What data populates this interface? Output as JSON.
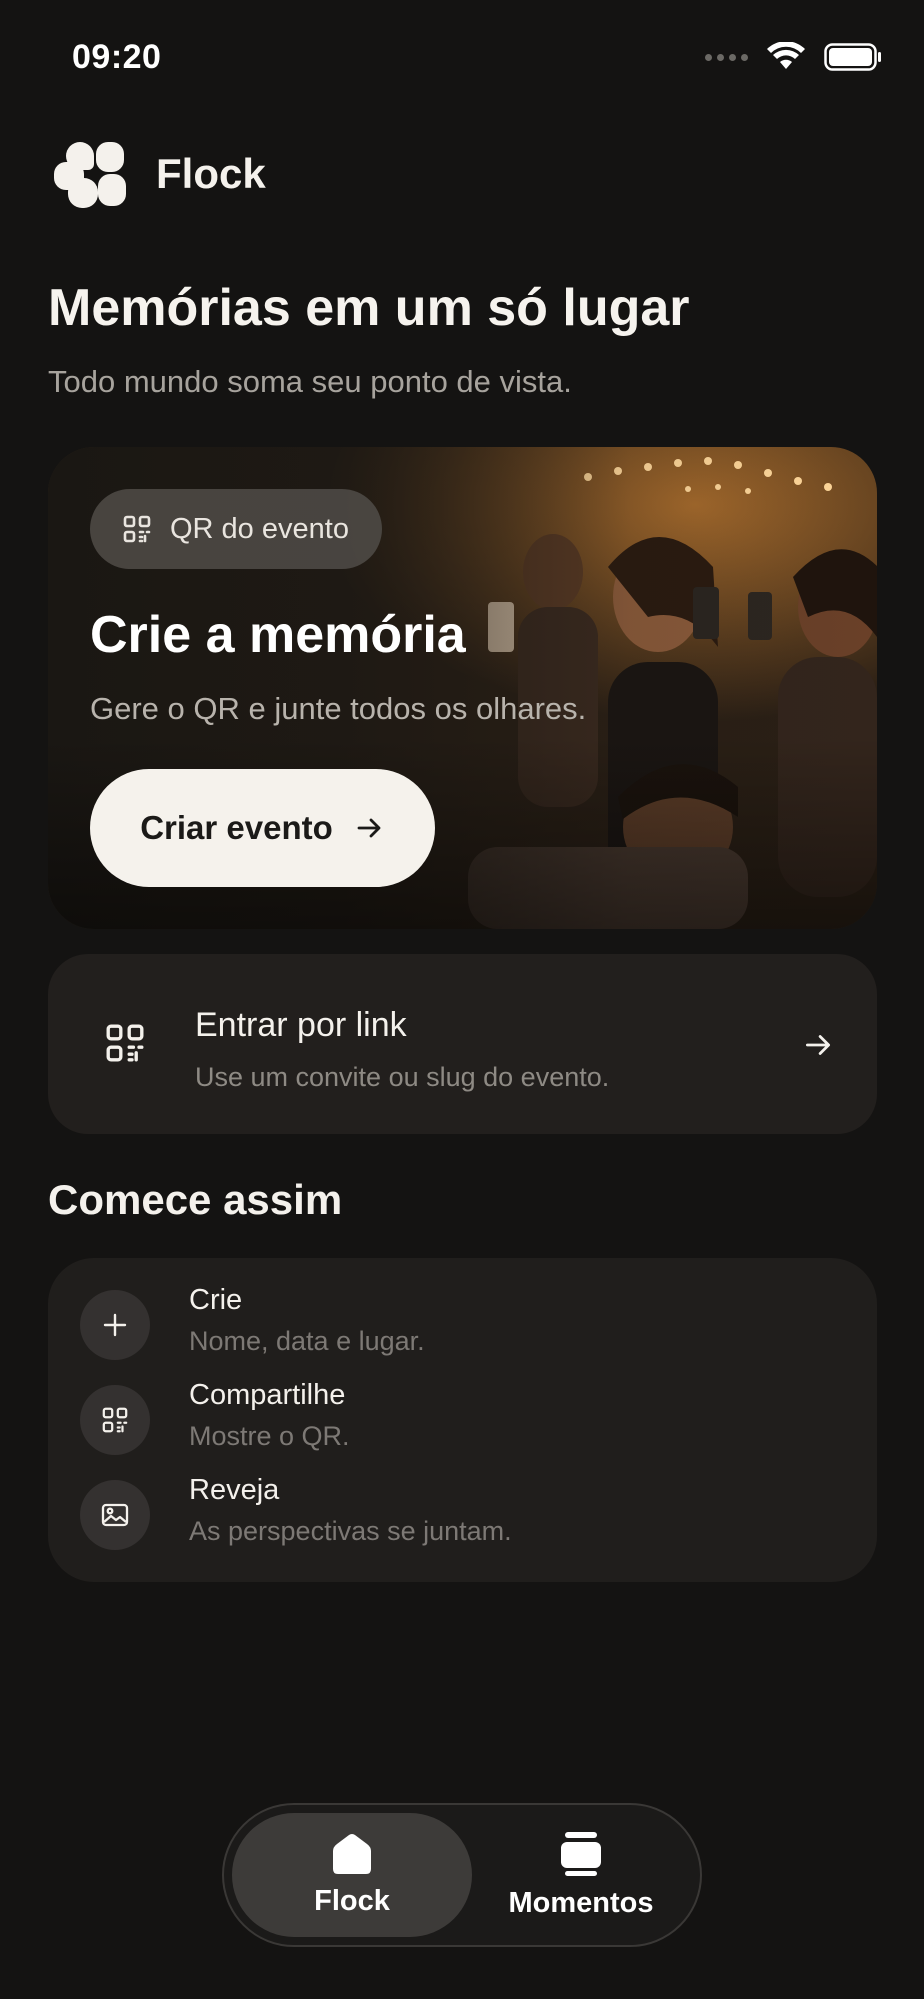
{
  "status_bar": {
    "time": "09:20"
  },
  "brand": {
    "name": "Flock"
  },
  "hero": {
    "title": "Memórias em um só lugar",
    "subtitle": "Todo mundo soma seu ponto de vista."
  },
  "create_card": {
    "chip_label": "QR do evento",
    "title": "Crie a memória",
    "subtitle": "Gere o QR e junte todos os olhares.",
    "button_label": "Criar evento"
  },
  "link_card": {
    "title": "Entrar por link",
    "subtitle": "Use um convite ou slug do evento."
  },
  "steps_section": {
    "title": "Comece assim",
    "items": [
      {
        "title": "Crie",
        "description": "Nome, data e lugar.",
        "icon": "plus-icon"
      },
      {
        "title": "Compartilhe",
        "description": "Mostre o QR.",
        "icon": "qr-icon"
      },
      {
        "title": "Reveja",
        "description": "As perspectivas se juntam.",
        "icon": "image-icon"
      }
    ]
  },
  "tabbar": {
    "tabs": [
      {
        "label": "Flock",
        "icon": "home-icon",
        "active": true
      },
      {
        "label": "Momentos",
        "icon": "stack-icon",
        "active": false
      }
    ]
  },
  "colors": {
    "background": "#141312",
    "card": "#221f1d",
    "accent_light": "#f5f2ec",
    "muted_text": "#8e8a84"
  }
}
